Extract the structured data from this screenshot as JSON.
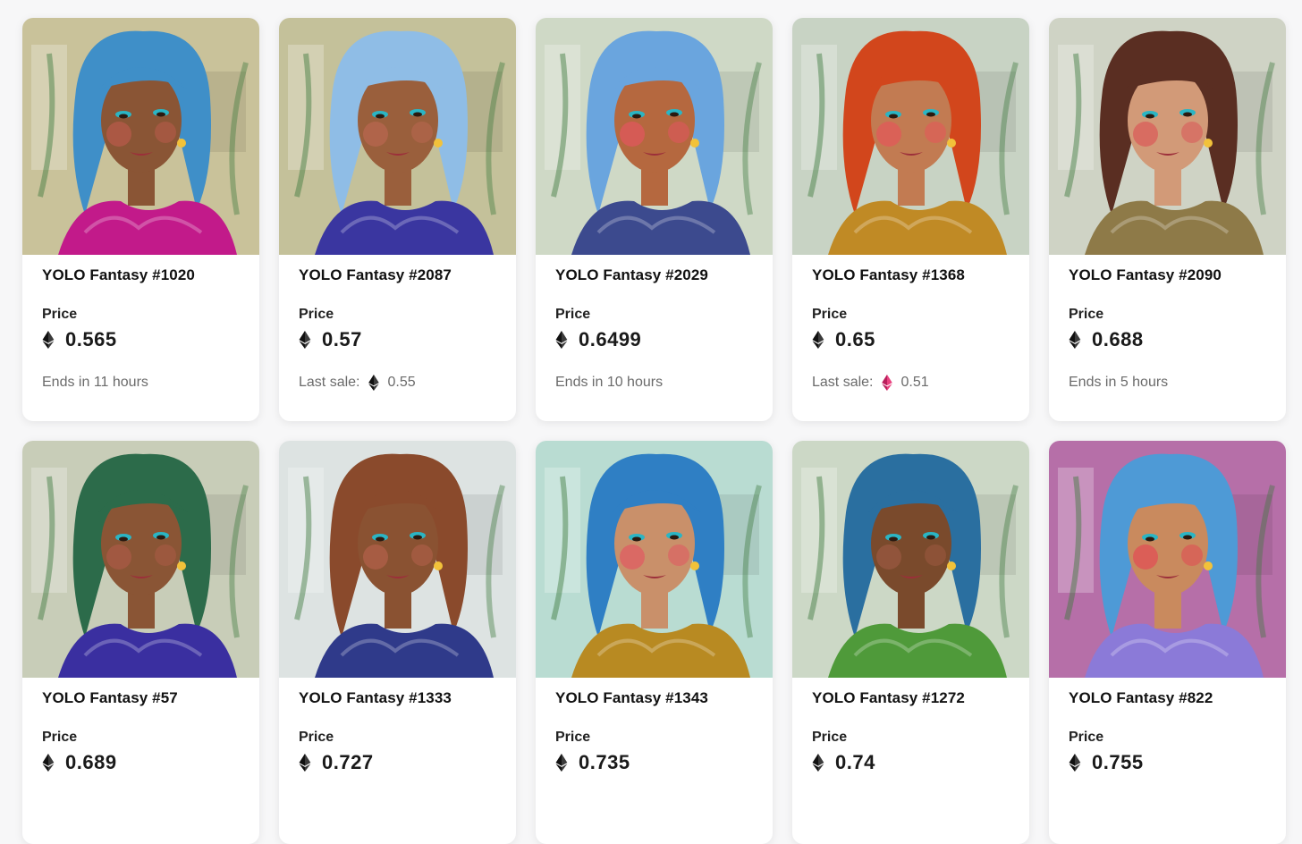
{
  "labels": {
    "price": "Price",
    "last_sale": "Last sale:"
  },
  "cards": [
    {
      "title": "YOLO Fantasy #1020",
      "price": "0.565",
      "meta_type": "ends",
      "meta": "Ends in 11 hours",
      "bg": "#c9c29a",
      "hair": "#3f8fc8",
      "skin": "#8a5535",
      "outfit": "#c21a8a",
      "cheek": "#b65a4a"
    },
    {
      "title": "YOLO Fantasy #2087",
      "price": "0.57",
      "meta_type": "sale",
      "sale_value": "0.55",
      "sale_token": "eth",
      "bg": "#c4c19a",
      "hair": "#8fbde6",
      "skin": "#9a5f3c",
      "outfit": "#3a36a0",
      "cheek": "#b7664f"
    },
    {
      "title": "YOLO Fantasy #2029",
      "price": "0.6499",
      "meta_type": "ends",
      "meta": "Ends in 10 hours",
      "bg": "#cfd9c6",
      "hair": "#6aa5de",
      "skin": "#b5683f",
      "outfit": "#3c4a8e",
      "cheek": "#e0575e"
    },
    {
      "title": "YOLO Fantasy #1368",
      "price": "0.65",
      "meta_type": "sale",
      "sale_value": "0.51",
      "sale_token": "weth",
      "bg": "#c8d3c4",
      "hair": "#d2461c",
      "skin": "#c27b52",
      "outfit": "#c08a25",
      "cheek": "#e2585a"
    },
    {
      "title": "YOLO Fantasy #2090",
      "price": "0.688",
      "meta_type": "ends",
      "meta": "Ends in 5 hours",
      "bg": "#cfd3c5",
      "hair": "#5a2e22",
      "skin": "#d29a78",
      "outfit": "#8e7a48",
      "cheek": "#d95c5a"
    },
    {
      "title": "YOLO Fantasy #57",
      "price": "0.689",
      "bg": "#c8cdb8",
      "hair": "#2c6b4a",
      "skin": "#8a5535",
      "outfit": "#3a2fa0",
      "cheek": "#a85a45"
    },
    {
      "title": "YOLO Fantasy #1333",
      "price": "0.727",
      "bg": "#dde3e2",
      "hair": "#8a4a2c",
      "skin": "#8a5232",
      "outfit": "#2f3a8a",
      "cheek": "#b0604a"
    },
    {
      "title": "YOLO Fantasy #1343",
      "price": "0.735",
      "bg": "#b9dcd2",
      "hair": "#2f7fc4",
      "skin": "#c9906a",
      "outfit": "#b88a22",
      "cheek": "#df5c63"
    },
    {
      "title": "YOLO Fantasy #1272",
      "price": "0.74",
      "bg": "#ccd8c6",
      "hair": "#2a6fa0",
      "skin": "#7a4a2c",
      "outfit": "#4f9a3a",
      "cheek": "#9a5840"
    },
    {
      "title": "YOLO Fantasy #822",
      "price": "0.755",
      "bg": "#b66fa8",
      "hair": "#4e9ad6",
      "skin": "#c98a5e",
      "outfit": "#8b7ad8",
      "cheek": "#e04f55"
    }
  ]
}
